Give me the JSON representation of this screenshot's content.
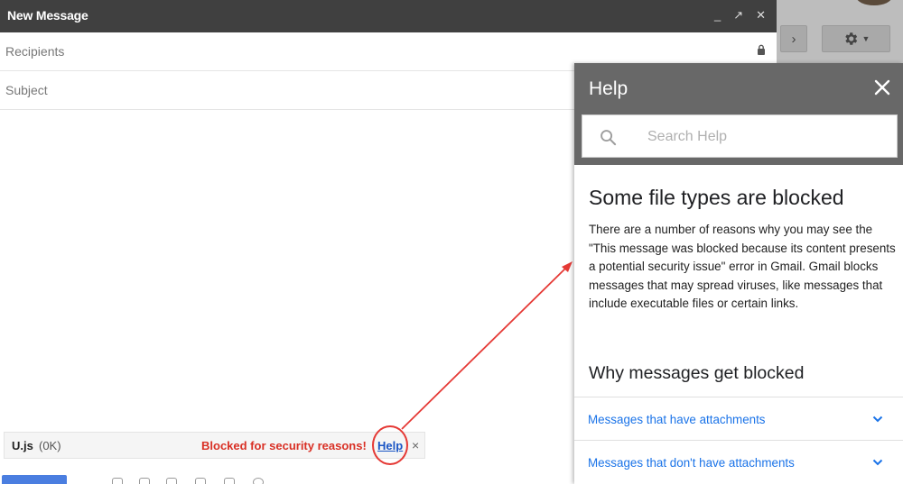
{
  "compose": {
    "title": "New Message",
    "controls": {
      "minimize": "_",
      "popout": "↗",
      "close": "✕"
    },
    "recipients_placeholder": "Recipients",
    "subject_placeholder": "Subject"
  },
  "attachment": {
    "name": "U.js",
    "size": "(0K)",
    "blocked_message": "Blocked for security reasons!",
    "help_link": "Help",
    "remove": "×"
  },
  "background": {
    "next_icon": "chevron-right-icon",
    "settings_icon": "gear-icon"
  },
  "help_panel": {
    "title": "Help",
    "search_placeholder": "Search Help",
    "article_title": "Some file types are blocked",
    "article_body": "There are a number of reasons why you may see the \"This message was blocked because its content presents a potential security issue\" error in Gmail. Gmail blocks messages that may spread viruses, like messages that include executable files or certain links.",
    "section_title": "Why messages get blocked",
    "accordion": [
      {
        "label": "Messages that have attachments"
      },
      {
        "label": "Messages that don't have attachments"
      }
    ]
  },
  "colors": {
    "compose_header": "#404040",
    "help_header": "#686868",
    "blocked_text": "#d93025",
    "link_blue": "#1a73e8",
    "annotation_red": "#e53935"
  }
}
